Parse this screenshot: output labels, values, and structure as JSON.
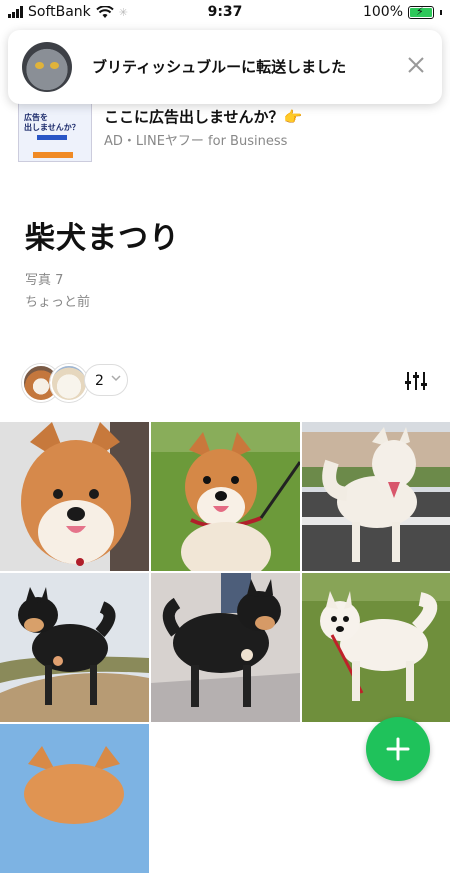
{
  "status_bar": {
    "carrier": "SoftBank",
    "time": "9:37",
    "battery": "100%",
    "battery_level": 1.0
  },
  "notification": {
    "message": "ブリティッシュブルーに転送しました",
    "avatar_icon": "cat-avatar",
    "close_icon": "close-icon"
  },
  "ad": {
    "title": "ここに広告出しませんか？👉",
    "subtitle": "AD・LINEヤフー for Business",
    "thumb_text": "広告を\n出しませんか？"
  },
  "album": {
    "title": "柴犬まつり",
    "photo_count": "写真 7",
    "updated": "ちょっと前"
  },
  "members": {
    "count": "2"
  },
  "photos": [
    {
      "subject": "shiba-red-face"
    },
    {
      "subject": "shiba-red-grass"
    },
    {
      "subject": "shiba-white-road"
    },
    {
      "subject": "shiba-black-sand"
    },
    {
      "subject": "shiba-black-road"
    },
    {
      "subject": "shiba-white-grass"
    },
    {
      "subject": "shiba-red-sky"
    }
  ],
  "colors": {
    "accent": "#1fc25b",
    "muted": "#888888"
  }
}
